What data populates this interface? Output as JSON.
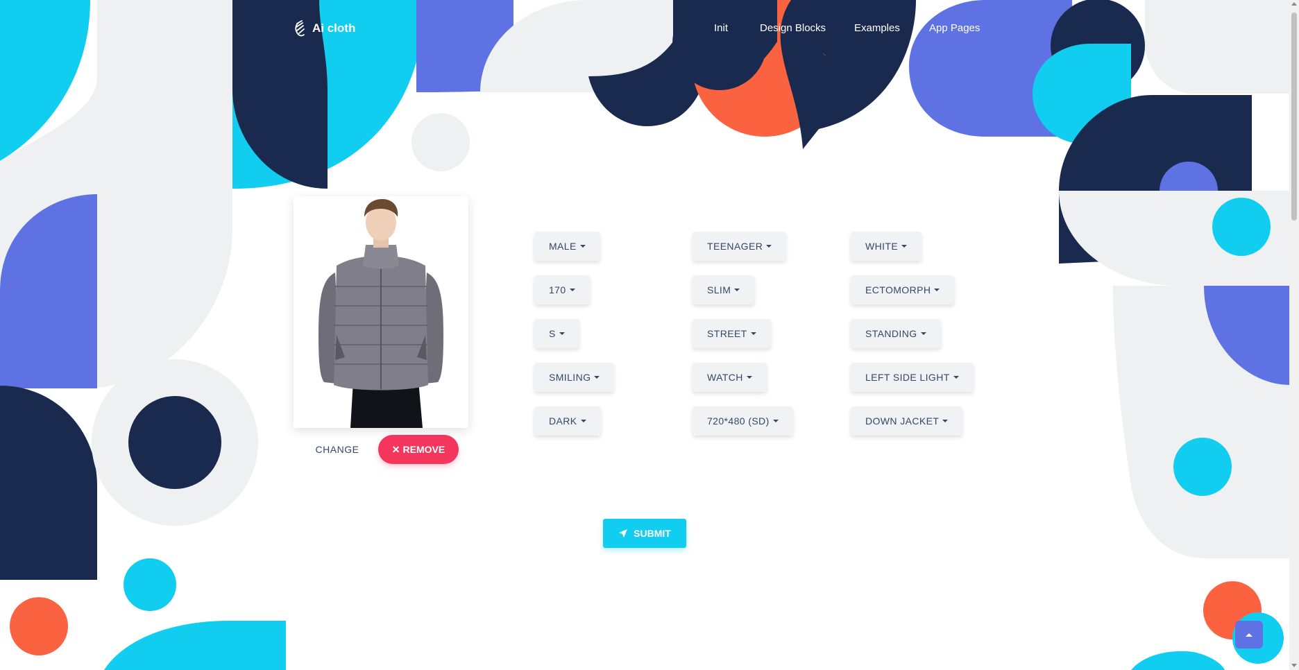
{
  "navbar": {
    "brand": "Ai cloth",
    "links": [
      "Init",
      "Design Blocks",
      "Examples",
      "App Pages"
    ]
  },
  "upload": {
    "change_label": "CHANGE",
    "remove_label": "REMOVE"
  },
  "dropdowns": [
    [
      "MALE",
      "TEENAGER",
      "WHITE"
    ],
    [
      "170",
      "SLIM",
      "ECTOMORPH"
    ],
    [
      "S",
      "STREET",
      "STANDING"
    ],
    [
      "SMILING",
      "WATCH",
      "LEFT SIDE LIGHT"
    ],
    [
      "DARK",
      "720*480 (SD)",
      "DOWN JACKET"
    ]
  ],
  "submit_label": "SUBMIT",
  "colors": {
    "navy": "#1a2a4e",
    "cyan": "#11cdef",
    "indigo": "#5e72e4",
    "orange": "#fb6340",
    "light_gray": "#eef0f1",
    "danger": "#f5365c"
  },
  "icons": {
    "brand": "hand-logo-icon",
    "remove": "close-icon",
    "submit": "send-icon",
    "scrolltop": "chevron-up-icon"
  }
}
